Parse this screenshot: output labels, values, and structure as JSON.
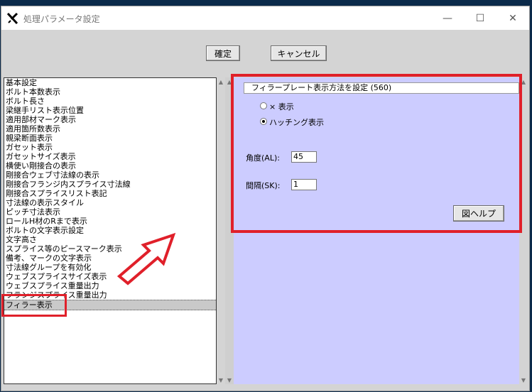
{
  "window": {
    "title": "処理パラメータ設定",
    "controls": {
      "minimize": "—",
      "maximize": "☐",
      "close": "✕"
    }
  },
  "toolbar": {
    "ok_label": "確定",
    "cancel_label": "キャンセル"
  },
  "list": {
    "items": [
      "基本設定",
      "ボルト本数表示",
      "ボルト長さ",
      "梁継手リスト表示位置",
      "適用部材マーク表示",
      "適用箇所数表示",
      "親梁断面表示",
      "ガセット表示",
      "ガセットサイズ表示",
      "横使い剛接合の表示",
      "剛接合ウェブ寸法線の表示",
      "剛接合フランジ内スプライス寸法線",
      "剛接合スプライスリスト表記",
      "寸法線の表示スタイル",
      "ピッチ寸法表示",
      "ロールH材のRまで表示",
      "ボルトの文字表示設定",
      "文字高さ",
      "スプライス等のピースマーク表示",
      "備考、マークの文字表示",
      "寸法線グループを有効化",
      "ウェブスプライスサイズ表示",
      "ウェブスプライス重量出力",
      "フランジスプライス重量出力",
      "フィラー表示"
    ],
    "selected_index": 24
  },
  "panel": {
    "header": "フィラープレート表示方法を設定 (560)",
    "radio_options": [
      "× 表示",
      "ハッチング表示"
    ],
    "selected_option": 1,
    "angle_label": "角度(AL):",
    "angle_value": "45",
    "interval_label": "間隔(SK):",
    "interval_value": "1",
    "help_button": "図ヘルプ"
  },
  "colors": {
    "panel_bg": "#ccccff",
    "highlight_red": "#e0202a",
    "window_bg": "#d4d4d4"
  }
}
